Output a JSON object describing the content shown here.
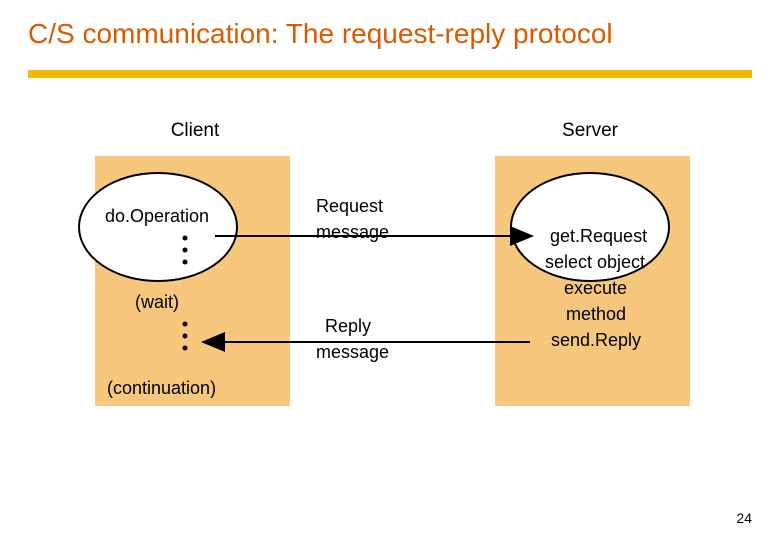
{
  "title": "C/S communication: The request-reply protocol",
  "client": {
    "label": "Client",
    "op1": "do.Operation",
    "wait": "(wait)",
    "cont": "(continuation)"
  },
  "server": {
    "label": "Server",
    "line1": "get.Request",
    "line2": "select object",
    "line3": "execute",
    "line4": "method",
    "line5": "send.Reply"
  },
  "messages": {
    "req1": "Request",
    "req2": "message",
    "rep1": "Reply",
    "rep2": "message"
  },
  "pageNum": "24"
}
